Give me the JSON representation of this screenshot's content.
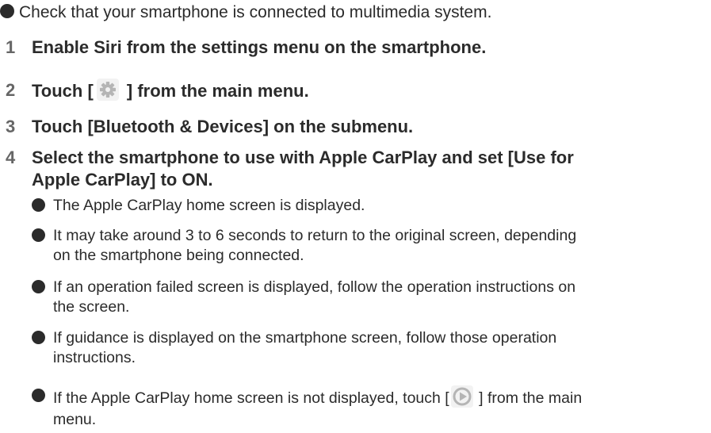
{
  "intro": {
    "text": "Check that your smartphone is connected to multimedia system."
  },
  "steps": [
    {
      "num": "1",
      "text": "Enable Siri from the settings menu on the smartphone."
    },
    {
      "num": "2",
      "text_before": "Touch [",
      "text_after": " ] from the main menu.",
      "icon": "gear-icon"
    },
    {
      "num": "3",
      "text": "Touch [Bluetooth & Devices] on the submenu."
    },
    {
      "num": "4",
      "lines": [
        "Select the smartphone to use with Apple CarPlay and set [Use for",
        "Apple CarPlay] to ON."
      ]
    }
  ],
  "notes": [
    {
      "lines": [
        "The Apple CarPlay home screen is displayed."
      ]
    },
    {
      "lines": [
        "It may take around 3 to 6 seconds to return to the original screen, depending",
        "on the smartphone being connected."
      ]
    },
    {
      "lines": [
        "If an operation failed screen is displayed, follow the operation instructions on",
        "the screen."
      ]
    },
    {
      "lines": [
        "If guidance is displayed on the smartphone screen, follow those operation",
        "instructions."
      ]
    },
    {
      "line1_before": "If the Apple CarPlay home screen is not displayed, touch [",
      "line1_after": " ] from the main",
      "line2": "menu.",
      "icon": "carplay-play-icon"
    }
  ],
  "colors": {
    "text": "#2b2b2b",
    "step_number": "#666666",
    "icon_gray": "#b5b5b5"
  }
}
